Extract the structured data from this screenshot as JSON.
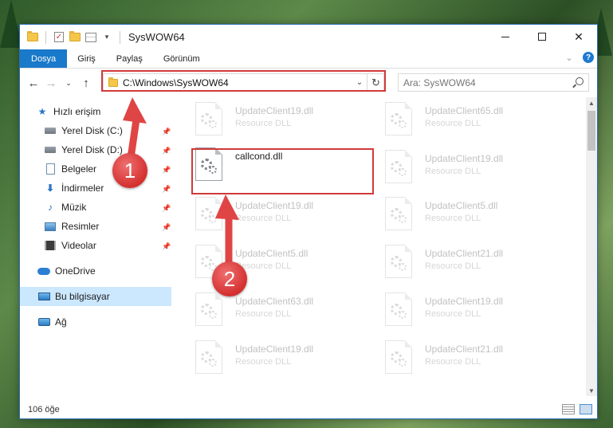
{
  "window": {
    "title": "SysWOW64",
    "controls": {
      "minimize": "minimize",
      "maximize": "maximize",
      "close": "✕"
    }
  },
  "ribbon": {
    "tabs": [
      "Dosya",
      "Giriş",
      "Paylaş",
      "Görünüm"
    ],
    "help": "?"
  },
  "address": {
    "path": "C:\\Windows\\SysWOW64",
    "search_placeholder": "Ara: SysWOW64"
  },
  "sidebar": {
    "quick_access": "Hızlı erişim",
    "items": [
      {
        "label": "Yerel Disk (C:)",
        "icon": "disk-icon"
      },
      {
        "label": "Yerel Disk (D:)",
        "icon": "disk-icon"
      },
      {
        "label": "Belgeler",
        "icon": "documents-icon"
      },
      {
        "label": "İndirmeler",
        "icon": "download-icon"
      },
      {
        "label": "Müzik",
        "icon": "music-icon"
      },
      {
        "label": "Resimler",
        "icon": "pictures-icon"
      },
      {
        "label": "Videolar",
        "icon": "videos-icon"
      }
    ],
    "onedrive": "OneDrive",
    "this_pc": "Bu bilgisayar",
    "network": "Ağ"
  },
  "files": {
    "highlighted": {
      "name": "callcond.dll",
      "desc": ""
    },
    "left_column": [
      {
        "name": "UpdateClient19.dll",
        "desc": "Resource DLL"
      },
      {
        "name": "UpdateClient19.dll",
        "desc": "Resource DLL"
      },
      {
        "name": "UpdateClient5.dll",
        "desc": "Resource DLL"
      },
      {
        "name": "UpdateClient63.dll",
        "desc": "Resource DLL"
      },
      {
        "name": "UpdateClient19.dll",
        "desc": "Resource DLL"
      }
    ],
    "right_column": [
      {
        "name": "UpdateClient65.dll",
        "desc": "Resource DLL"
      },
      {
        "name": "UpdateClient19.dll",
        "desc": "Resource DLL"
      },
      {
        "name": "UpdateClient5.dll",
        "desc": "Resource DLL"
      },
      {
        "name": "UpdateClient21.dll",
        "desc": "Resource DLL"
      },
      {
        "name": "UpdateClient19.dll",
        "desc": "Resource DLL"
      },
      {
        "name": "UpdateClient21.dll",
        "desc": "Resource DLL"
      }
    ]
  },
  "status": {
    "item_count": "106 öğe"
  },
  "annotations": {
    "step1": "1",
    "step2": "2",
    "color": "#d03a3a"
  }
}
